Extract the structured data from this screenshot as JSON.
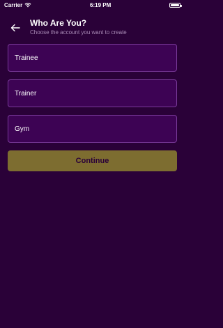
{
  "status_bar": {
    "carrier": "Carrier",
    "time": "6:19 PM"
  },
  "header": {
    "back_icon": "arrow-left-icon",
    "title": "Who Are You?",
    "subtitle": "Choose the account you want to create"
  },
  "options": [
    {
      "label": "Trainee"
    },
    {
      "label": "Trainer"
    },
    {
      "label": "Gym"
    }
  ],
  "continue_label": "Continue",
  "colors": {
    "background": "#2a0138",
    "option_fill": "#3d0354",
    "option_border": "#7a3a9a",
    "button": "#7d6d30",
    "subtitle": "#a98bb6"
  }
}
